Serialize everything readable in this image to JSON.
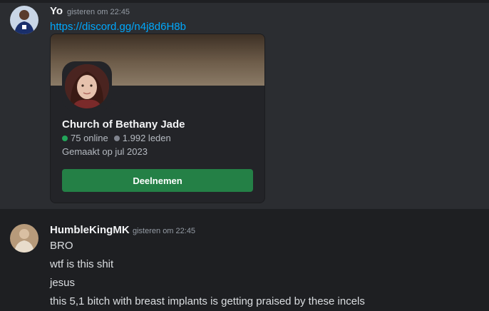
{
  "colors": {
    "link": "#00a8fc",
    "join_button": "#248046",
    "online_dot": "#23a55a",
    "member_dot": "#80848e"
  },
  "message1": {
    "author": "Yo",
    "timestamp": "gisteren om 22:45",
    "link": "https://discord.gg/n4j8d6H8b",
    "invite": {
      "guild_name": "Church of Bethany Jade",
      "online": "75 online",
      "members": "1.992 leden",
      "created": "Gemaakt op jul 2023",
      "join_label": "Deelnemen"
    }
  },
  "message2": {
    "author": "HumbleKingMK",
    "timestamp": "gisteren om 22:45",
    "lines": [
      "BRO",
      "wtf is this shit",
      "jesus",
      "this 5,1 bitch with breast implants is getting praised by these incels"
    ]
  }
}
